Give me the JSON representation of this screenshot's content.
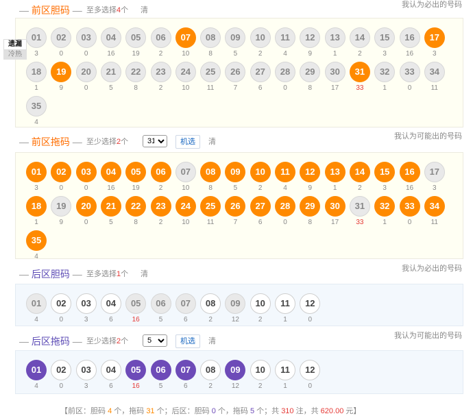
{
  "tabs": [
    "遗漏",
    "冷热"
  ],
  "sections": [
    {
      "key": "front_dan",
      "title": "前区胆码",
      "hint_prefix": "至多选择",
      "hint_num": "4",
      "hint_suffix": "个",
      "clear": "清",
      "right_text": "我认为必出的号码",
      "select": null,
      "random": null,
      "accent": "#ff6d00",
      "kind": "front",
      "balls": [
        {
          "n": "01",
          "s": "off",
          "m": "3"
        },
        {
          "n": "02",
          "s": "off",
          "m": "0"
        },
        {
          "n": "03",
          "s": "off",
          "m": "0"
        },
        {
          "n": "04",
          "s": "off",
          "m": "16"
        },
        {
          "n": "05",
          "s": "off",
          "m": "19"
        },
        {
          "n": "06",
          "s": "off",
          "m": "2"
        },
        {
          "n": "07",
          "s": "orange",
          "m": "10"
        },
        {
          "n": "08",
          "s": "off",
          "m": "8"
        },
        {
          "n": "09",
          "s": "off",
          "m": "5"
        },
        {
          "n": "10",
          "s": "off",
          "m": "2"
        },
        {
          "n": "11",
          "s": "off",
          "m": "4"
        },
        {
          "n": "12",
          "s": "off",
          "m": "9"
        },
        {
          "n": "13",
          "s": "off",
          "m": "1"
        },
        {
          "n": "14",
          "s": "off",
          "m": "2"
        },
        {
          "n": "15",
          "s": "off",
          "m": "3"
        },
        {
          "n": "16",
          "s": "off",
          "m": "16"
        },
        {
          "n": "17",
          "s": "orange",
          "m": "3"
        },
        {
          "n": "18",
          "s": "off",
          "m": "1"
        },
        {
          "n": "19",
          "s": "orange",
          "m": "9"
        },
        {
          "n": "20",
          "s": "off",
          "m": "0"
        },
        {
          "n": "21",
          "s": "off",
          "m": "5"
        },
        {
          "n": "22",
          "s": "off",
          "m": "8"
        },
        {
          "n": "23",
          "s": "off",
          "m": "2"
        },
        {
          "n": "24",
          "s": "off",
          "m": "10"
        },
        {
          "n": "25",
          "s": "off",
          "m": "11"
        },
        {
          "n": "26",
          "s": "off",
          "m": "7"
        },
        {
          "n": "27",
          "s": "off",
          "m": "6"
        },
        {
          "n": "28",
          "s": "off",
          "m": "0"
        },
        {
          "n": "29",
          "s": "off",
          "m": "8"
        },
        {
          "n": "30",
          "s": "off",
          "m": "17"
        },
        {
          "n": "31",
          "s": "orange",
          "m": "33",
          "hot": true
        },
        {
          "n": "32",
          "s": "off",
          "m": "1"
        },
        {
          "n": "33",
          "s": "off",
          "m": "0"
        },
        {
          "n": "34",
          "s": "off",
          "m": "11"
        },
        {
          "n": "35",
          "s": "off",
          "m": "4"
        }
      ]
    },
    {
      "key": "front_tuo",
      "title": "前区拖码",
      "hint_prefix": "至少选择",
      "hint_num": "2",
      "hint_suffix": "个",
      "clear": "清",
      "right_text": "我认为可能出的号码",
      "select": "31",
      "random": "机选",
      "accent": "#ff6d00",
      "kind": "front",
      "balls": [
        {
          "n": "01",
          "s": "orange",
          "m": "3"
        },
        {
          "n": "02",
          "s": "orange",
          "m": "0"
        },
        {
          "n": "03",
          "s": "orange",
          "m": "0"
        },
        {
          "n": "04",
          "s": "orange",
          "m": "16"
        },
        {
          "n": "05",
          "s": "orange",
          "m": "19"
        },
        {
          "n": "06",
          "s": "orange",
          "m": "2"
        },
        {
          "n": "07",
          "s": "off",
          "m": "10"
        },
        {
          "n": "08",
          "s": "orange",
          "m": "8"
        },
        {
          "n": "09",
          "s": "orange",
          "m": "5"
        },
        {
          "n": "10",
          "s": "orange",
          "m": "2"
        },
        {
          "n": "11",
          "s": "orange",
          "m": "4"
        },
        {
          "n": "12",
          "s": "orange",
          "m": "9"
        },
        {
          "n": "13",
          "s": "orange",
          "m": "1"
        },
        {
          "n": "14",
          "s": "orange",
          "m": "2"
        },
        {
          "n": "15",
          "s": "orange",
          "m": "3"
        },
        {
          "n": "16",
          "s": "orange",
          "m": "16"
        },
        {
          "n": "17",
          "s": "off",
          "m": "3"
        },
        {
          "n": "18",
          "s": "orange",
          "m": "1"
        },
        {
          "n": "19",
          "s": "off",
          "m": "9"
        },
        {
          "n": "20",
          "s": "orange",
          "m": "0"
        },
        {
          "n": "21",
          "s": "orange",
          "m": "5"
        },
        {
          "n": "22",
          "s": "orange",
          "m": "8"
        },
        {
          "n": "23",
          "s": "orange",
          "m": "2"
        },
        {
          "n": "24",
          "s": "orange",
          "m": "10"
        },
        {
          "n": "25",
          "s": "orange",
          "m": "11"
        },
        {
          "n": "26",
          "s": "orange",
          "m": "7"
        },
        {
          "n": "27",
          "s": "orange",
          "m": "6"
        },
        {
          "n": "28",
          "s": "orange",
          "m": "0"
        },
        {
          "n": "29",
          "s": "orange",
          "m": "8"
        },
        {
          "n": "30",
          "s": "orange",
          "m": "17"
        },
        {
          "n": "31",
          "s": "off",
          "m": "33",
          "hot": true
        },
        {
          "n": "32",
          "s": "orange",
          "m": "1"
        },
        {
          "n": "33",
          "s": "orange",
          "m": "0"
        },
        {
          "n": "34",
          "s": "orange",
          "m": "11"
        },
        {
          "n": "35",
          "s": "orange",
          "m": "4"
        }
      ]
    },
    {
      "key": "back_dan",
      "title": "后区胆码",
      "hint_prefix": "至多选择",
      "hint_num": "1",
      "hint_suffix": "个",
      "clear": "清",
      "right_text": "我认为必出的号码",
      "select": null,
      "random": null,
      "accent": "#5c4bb5",
      "kind": "back",
      "balls": [
        {
          "n": "01",
          "s": "off",
          "m": "4"
        },
        {
          "n": "02",
          "s": "white",
          "m": "0"
        },
        {
          "n": "03",
          "s": "white",
          "m": "3"
        },
        {
          "n": "04",
          "s": "white",
          "m": "6"
        },
        {
          "n": "05",
          "s": "off",
          "m": "16",
          "hot": true
        },
        {
          "n": "06",
          "s": "off",
          "m": "5"
        },
        {
          "n": "07",
          "s": "off",
          "m": "6"
        },
        {
          "n": "08",
          "s": "white",
          "m": "2"
        },
        {
          "n": "09",
          "s": "off",
          "m": "12"
        },
        {
          "n": "10",
          "s": "white",
          "m": "2"
        },
        {
          "n": "11",
          "s": "white",
          "m": "1"
        },
        {
          "n": "12",
          "s": "white",
          "m": "0"
        }
      ]
    },
    {
      "key": "back_tuo",
      "title": "后区拖码",
      "hint_prefix": "至少选择",
      "hint_num": "2",
      "hint_suffix": "个",
      "clear": "清",
      "right_text": "我认为可能出的号码",
      "select": "5",
      "random": "机选",
      "accent": "#5c4bb5",
      "kind": "back",
      "balls": [
        {
          "n": "01",
          "s": "purple",
          "m": "4"
        },
        {
          "n": "02",
          "s": "white",
          "m": "0"
        },
        {
          "n": "03",
          "s": "white",
          "m": "3"
        },
        {
          "n": "04",
          "s": "white",
          "m": "6"
        },
        {
          "n": "05",
          "s": "purple",
          "m": "16",
          "hot": true
        },
        {
          "n": "06",
          "s": "purple",
          "m": "5"
        },
        {
          "n": "07",
          "s": "purple",
          "m": "6"
        },
        {
          "n": "08",
          "s": "white",
          "m": "2"
        },
        {
          "n": "09",
          "s": "purple",
          "m": "12"
        },
        {
          "n": "10",
          "s": "white",
          "m": "2"
        },
        {
          "n": "11",
          "s": "white",
          "m": "1"
        },
        {
          "n": "12",
          "s": "white",
          "m": "0"
        }
      ]
    }
  ],
  "summary": {
    "open": "【前区：胆码",
    "dan_front": "4",
    "unit1": "个，拖码",
    "tuo_front": "31",
    "unit2": "个；后区：胆码",
    "dan_back": "0",
    "unit3": "个，拖码",
    "tuo_back": "5",
    "unit4": "个；共",
    "bets": "310",
    "unit5": "注，共",
    "amount": "620.00",
    "close": "元】"
  }
}
